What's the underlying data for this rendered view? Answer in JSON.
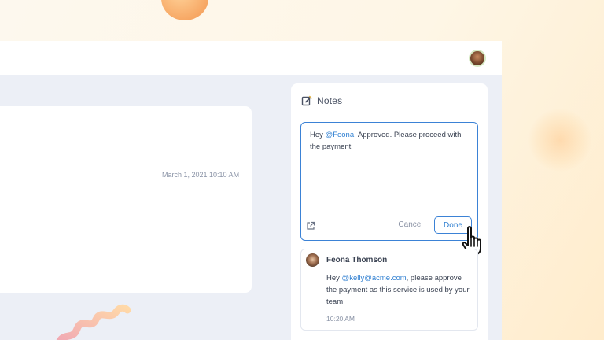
{
  "main_card": {
    "timestamp": "March 1, 2021 10:10 AM"
  },
  "notes": {
    "title": "Notes",
    "title_icon": "edit-note-icon",
    "editor": {
      "text_before": "Hey ",
      "mention": "@Feona",
      "text_after": ". Approved. Please proceed with the payment"
    },
    "popout_icon": "external-link-icon",
    "cancel_label": "Cancel",
    "done_label": "Done"
  },
  "comment": {
    "author": "Feona Thomson",
    "text_before": "Hey ",
    "mention": "@kelly@acme.com",
    "text_after": ", please approve the payment as this service is used by your team.",
    "time": "10:20 AM"
  },
  "colors": {
    "accent": "#3b82d6",
    "mention": "#2f7fd1",
    "app_background": "#eceff6",
    "page_background": "#fdf8ee"
  }
}
